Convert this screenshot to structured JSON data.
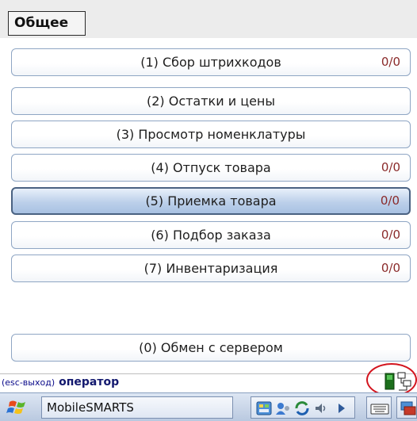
{
  "header": {
    "tab_label": "Общее"
  },
  "menu": [
    {
      "label": "(1) Сбор штрихкодов",
      "count": "0/0",
      "selected": false
    },
    {
      "label": "(2) Остатки и цены",
      "count": "",
      "selected": false
    },
    {
      "label": "(3) Просмотр номенклатуры",
      "count": "",
      "selected": false
    },
    {
      "label": "(4) Отпуск товара",
      "count": "0/0",
      "selected": false
    },
    {
      "label": "(5) Приемка товара",
      "count": "0/0",
      "selected": true
    },
    {
      "label": "(6) Подбор заказа",
      "count": "0/0",
      "selected": false
    },
    {
      "label": "(7) Инвентаризация",
      "count": "0/0",
      "selected": false
    }
  ],
  "exchange_button": {
    "label": "(0) Обмен с сервером"
  },
  "status": {
    "hint": "(esc-выход)",
    "operator": "оператор"
  },
  "taskbar": {
    "app_name": "MobileSMARTS"
  },
  "icons": {
    "start": "windows-flag-icon",
    "connection": "network-connection-icon",
    "tray": [
      "program-icon",
      "user-icon",
      "sync-icon",
      "volume-icon",
      "arrow-right-icon"
    ],
    "keyboard": "keyboard-icon"
  },
  "colors": {
    "annotation_circle": "#d3141e",
    "selected_row": "#bcd0ea",
    "counter": "#8a2a2a"
  }
}
